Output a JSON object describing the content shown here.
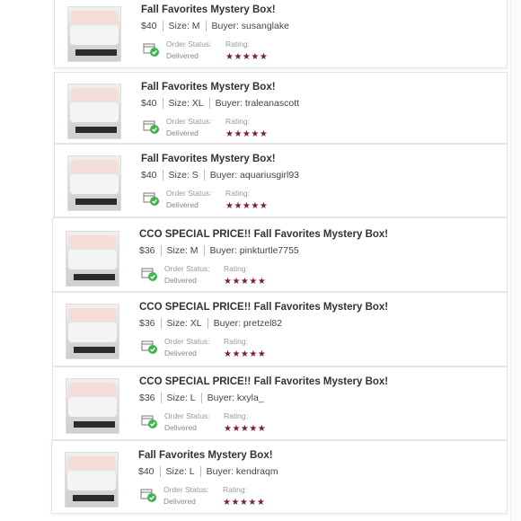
{
  "labels": {
    "order_status": "Order Status:",
    "rating": "Rating:"
  },
  "colors": {
    "star": "#7d1e2d",
    "check": "#3cb54a"
  },
  "orders": [
    {
      "title": "Fall Favorites Mystery Box!",
      "price": "$40",
      "size": "Size: M",
      "buyer": "Buyer: susanglake",
      "status": "Delivered",
      "stars": "★★★★★"
    },
    {
      "title": "Fall Favorites Mystery Box!",
      "price": "$40",
      "size": "Size: XL",
      "buyer": "Buyer: traleanascott",
      "status": "Delivered",
      "stars": "★★★★★"
    },
    {
      "title": "Fall Favorites Mystery Box!",
      "price": "$40",
      "size": "Size: S",
      "buyer": "Buyer: aquariusgirl93",
      "status": "Delivered",
      "stars": "★★★★★"
    },
    {
      "title": "CCO SPECIAL PRICE!! Fall Favorites Mystery Box!",
      "price": "$36",
      "size": "Size: M",
      "buyer": "Buyer: pinkturtle7755",
      "status": "Delivered",
      "stars": "★★★★★"
    },
    {
      "title": "CCO SPECIAL PRICE!! Fall Favorites Mystery Box!",
      "price": "$36",
      "size": "Size: XL",
      "buyer": "Buyer: pretzel82",
      "status": "Delivered",
      "stars": "★★★★★"
    },
    {
      "title": "CCO SPECIAL PRICE!! Fall Favorites Mystery Box!",
      "price": "$36",
      "size": "Size: L",
      "buyer": "Buyer: kxyla_",
      "status": "Delivered",
      "stars": "★★★★★"
    },
    {
      "title": "Fall Favorites Mystery Box!",
      "price": "$40",
      "size": "Size: L",
      "buyer": "Buyer: kendraqm",
      "status": "Delivered",
      "stars": "★★★★★"
    }
  ]
}
